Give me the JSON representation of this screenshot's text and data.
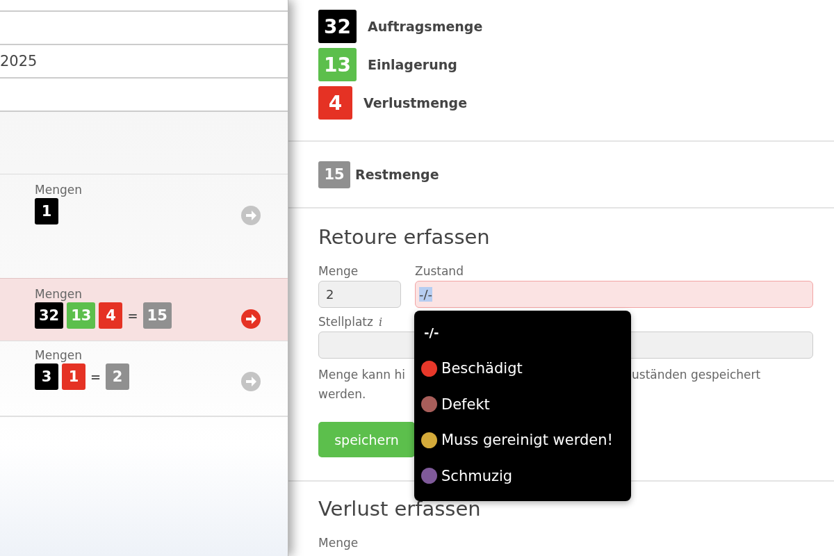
{
  "left_panel": {
    "top_fields": [
      {
        "value": "2025"
      }
    ],
    "orders": [
      {
        "quantity_label": "Mengen",
        "selected": false,
        "badges": [
          {
            "kind": "order",
            "value": "1"
          }
        ]
      },
      {
        "quantity_label": "Mengen",
        "selected": true,
        "badges": [
          {
            "kind": "order",
            "value": "32"
          },
          {
            "kind": "stored",
            "value": "13"
          },
          {
            "kind": "loss",
            "value": "4"
          }
        ],
        "equals": "=",
        "rest": "15"
      },
      {
        "quantity_label": "Mengen",
        "selected": false,
        "badges": [
          {
            "kind": "order",
            "value": "3"
          },
          {
            "kind": "loss",
            "value": "1"
          }
        ],
        "equals": "=",
        "rest": "2"
      }
    ]
  },
  "detail": {
    "summary": [
      {
        "kind": "order",
        "value": "32",
        "label": "Auftragsmenge"
      },
      {
        "kind": "stored",
        "value": "13",
        "label": "Einlagerung"
      },
      {
        "kind": "loss",
        "value": "4",
        "label": "Verlustmenge"
      }
    ],
    "rest": {
      "kind": "rest",
      "value": "15",
      "label": "Restmenge"
    },
    "return_form": {
      "title": "Retoure erfassen",
      "quantity": {
        "label": "Menge",
        "value": "2"
      },
      "condition": {
        "label": "Zustand",
        "value": "-/-",
        "invalid": true,
        "expanded": true,
        "options": [
          {
            "label": "-/-"
          },
          {
            "label": "Beschädigt",
            "color": "#e8382a"
          },
          {
            "label": "Defekt",
            "color": "#a85e5a"
          },
          {
            "label": "Muss gereinigt werden!",
            "color": "#d4aa3a"
          },
          {
            "label": "Schmuzig",
            "color": "#7f5a9a"
          }
        ]
      },
      "location": {
        "label": "Stellplatz",
        "info": "i"
      },
      "hint_parts": [
        "Menge kann hi",
        "uständen gespeichert",
        "werden."
      ],
      "button": "speichern"
    },
    "loss_form": {
      "title": "Verlust erfassen",
      "quantity_label": "Menge"
    }
  }
}
